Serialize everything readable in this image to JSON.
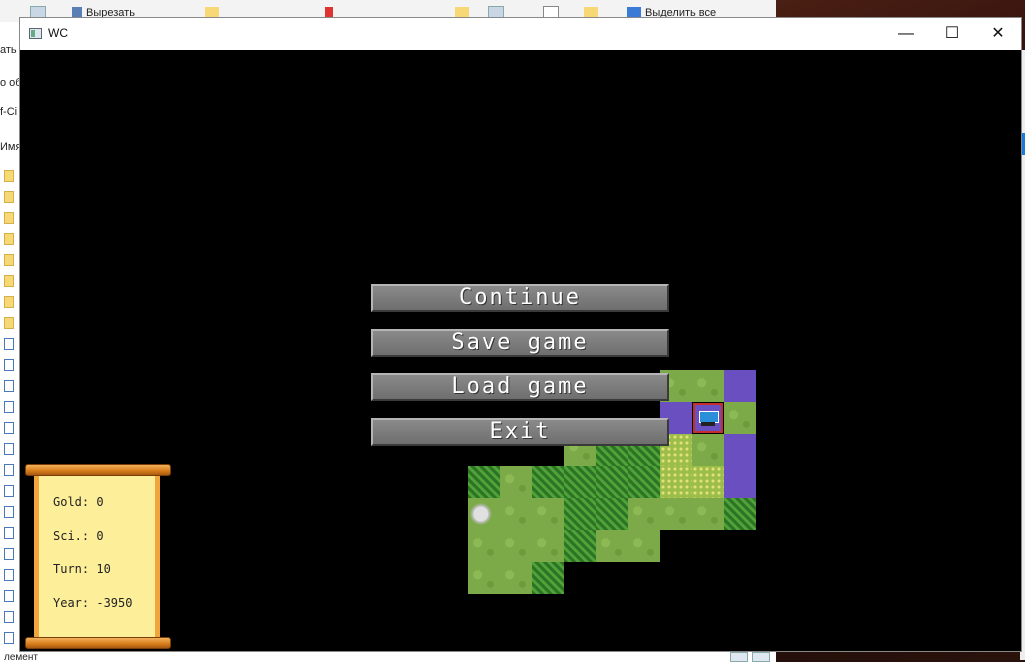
{
  "background": {
    "ribbon": {
      "cut_label": "Вырезать",
      "select_all_label": "Выделить все"
    },
    "left_fragments": [
      "ать",
      "о об",
      "f-Ci",
      "Имя"
    ],
    "status_fragment": "лемент"
  },
  "window": {
    "title": "WC"
  },
  "menu": {
    "continue_label": "Continue",
    "save_label": "Save game",
    "load_label": "Load game",
    "exit_label": "Exit"
  },
  "stats": {
    "gold_label": "Gold: 0",
    "sci_label": "Sci.: 0",
    "turn_label": "Turn: 10",
    "year_label": "Year: -3950",
    "gold": 0,
    "science": 0,
    "turn": 10,
    "year": -3950
  },
  "map": {
    "terrain_types": [
      "grassland",
      "forest",
      "water",
      "plains",
      "hills"
    ],
    "unit": "settler"
  }
}
